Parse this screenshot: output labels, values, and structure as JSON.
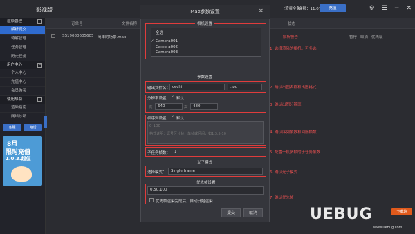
{
  "app": {
    "title": "影视版"
  },
  "sidebar": {
    "sections": [
      {
        "label": "渲染管理",
        "items": [
          "解析提交",
          "待解管理",
          "任务管理",
          "历史任务"
        ]
      },
      {
        "label": "用户中心",
        "items": [
          "个人中心",
          "充值中心",
          "会员购买"
        ]
      },
      {
        "label": "使用帮助",
        "items": [
          "渲染指南",
          "网络诊断"
        ]
      }
    ],
    "buttons": [
      "客服",
      "电话"
    ],
    "promo": {
      "line1": "8月",
      "line2": "限时充值",
      "line3": "1.0.3.超值"
    }
  },
  "table": {
    "headers": [
      "订单号",
      "文件名称",
      "状态"
    ],
    "row": {
      "order": "SS19080605605",
      "file": "简单的场景.max",
      "status": "解析警告",
      "actions": [
        "暂停",
        "取消",
        "优先级"
      ]
    }
  },
  "topbar": {
    "account_label": "(渲费全免)",
    "balance_label": "余额：11.07",
    "recharge": "充值"
  },
  "dialog": {
    "title": "Max参数设置",
    "camera_group": {
      "title": "相机设置",
      "select_all": "全选",
      "cameras": [
        "Camera001",
        "Camera002",
        "Camera003"
      ]
    },
    "params_title": "参数设置",
    "output": {
      "label": "输出文件名：",
      "name": "cechi",
      "format": ".jpg"
    },
    "resolution": {
      "label": "分辨率设置：",
      "default": "默认",
      "w_label": "宽：",
      "w": "640",
      "h_label": "高：",
      "h": "480"
    },
    "frames": {
      "label": "帧序列设置：",
      "default": "默认",
      "value": "0-100",
      "hint": "格式说明：逗号区分帧，单帧或区间，如1,3,5-10"
    },
    "sub_frames": {
      "label": "子任务帧数：",
      "value": "1"
    },
    "light_title": "光子模式",
    "light": {
      "label": "选择模式：",
      "value": "Single frame"
    },
    "priority_title": "优先帧设置",
    "priority": {
      "value": "0,50,100",
      "option": "优先帧渲染完成后，自动开始渲染"
    },
    "submit": "提交",
    "cancel": "取消"
  },
  "annotations": [
    "1. 选择渲染的相机，可多选",
    "2. 确认出图名称和出图格式",
    "3. 确认出图分辨率",
    "4. 确认序列帧数和间隔帧数",
    "5. 配置一机多帧的子任务帧数",
    "6. 确认光子模式",
    "7. 确认优先帧"
  ],
  "watermark": {
    "logo": "UEBUG",
    "badge": "下载站",
    "sub": "www.uebug.com"
  },
  "colors": {
    "accent": "#3a6fc6",
    "annotation": "#e03c3c"
  }
}
